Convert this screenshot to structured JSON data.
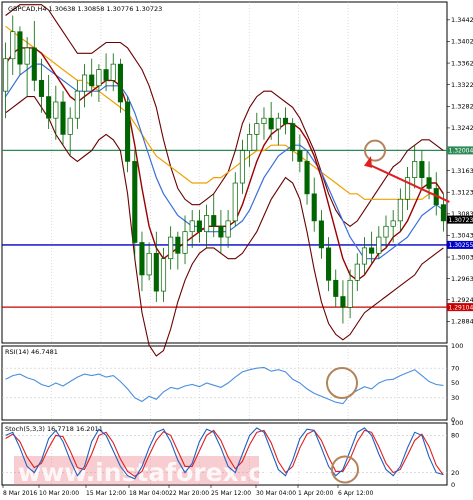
{
  "colors": {
    "background": "#ffffff",
    "frame": "#000000",
    "grid": "#c8c8c8",
    "candle": "#006400",
    "sma_red": "#9b0000",
    "sma_blue": "#3a6fd8",
    "sma_orange": "#f0a000",
    "bollinger": "#6a0000",
    "green_line": "#2e8b57",
    "blue_line": "#0000cc",
    "red_line": "#cc0000",
    "rsi": "#4a8fe0",
    "stoch_main": "#1f5fbf",
    "stoch_signal": "#e02020",
    "annotation": "#b5835a",
    "arrow": "#e02020",
    "watermark": "#e8707a"
  },
  "chart_data": [
    {
      "type": "line",
      "title": "GBPCAD,H4  1.30638 1.30858 1.30776 1.30723",
      "main_price_pane": {
        "symbol": "GBPCAD",
        "timeframe": "H4",
        "ohlc": [
          1.30638,
          1.30858,
          1.30776,
          1.30723
        ],
        "ylim": [
          1.2844,
          1.3475
        ],
        "y_ticks": [
          "1.34420",
          "1.34020",
          "1.33620",
          "1.33220",
          "1.32820",
          "1.32420",
          "1.31630",
          "1.31230",
          "1.30830",
          "1.30430",
          "1.30030",
          "1.29630",
          "1.29240",
          "1.28840"
        ],
        "price_tags": [
          {
            "label": "1.32004",
            "value": 1.32004,
            "line": "green"
          },
          {
            "label": "1.30723",
            "value": 1.30723,
            "line": "current"
          },
          {
            "label": "1.30255",
            "value": 1.30255,
            "line": "blue"
          },
          {
            "label": "1.29104",
            "value": 1.29104,
            "line": "red"
          }
        ],
        "candles": [
          [
            1.331,
            1.34,
            1.326,
            1.337
          ],
          [
            1.337,
            1.345,
            1.334,
            1.342
          ],
          [
            1.342,
            1.343,
            1.334,
            1.336
          ],
          [
            1.336,
            1.341,
            1.33,
            1.339
          ],
          [
            1.339,
            1.344,
            1.331,
            1.333
          ],
          [
            1.333,
            1.337,
            1.327,
            1.33
          ],
          [
            1.33,
            1.334,
            1.324,
            1.326
          ],
          [
            1.326,
            1.332,
            1.322,
            1.329
          ],
          [
            1.329,
            1.331,
            1.321,
            1.323
          ],
          [
            1.323,
            1.328,
            1.319,
            1.326
          ],
          [
            1.326,
            1.333,
            1.324,
            1.331
          ],
          [
            1.331,
            1.336,
            1.328,
            1.334
          ],
          [
            1.334,
            1.337,
            1.33,
            1.332
          ],
          [
            1.332,
            1.336,
            1.329,
            1.335
          ],
          [
            1.335,
            1.338,
            1.331,
            1.333
          ],
          [
            1.333,
            1.338,
            1.331,
            1.336
          ],
          [
            1.336,
            1.337,
            1.327,
            1.329
          ],
          [
            1.329,
            1.33,
            1.316,
            1.318
          ],
          [
            1.318,
            1.32,
            1.3,
            1.303
          ],
          [
            1.303,
            1.305,
            1.294,
            1.297
          ],
          [
            1.297,
            1.303,
            1.296,
            1.301
          ],
          [
            1.301,
            1.305,
            1.292,
            1.294
          ],
          [
            1.294,
            1.302,
            1.292,
            1.3
          ],
          [
            1.3,
            1.306,
            1.298,
            1.304
          ],
          [
            1.304,
            1.305,
            1.298,
            1.301
          ],
          [
            1.301,
            1.308,
            1.299,
            1.305
          ],
          [
            1.305,
            1.309,
            1.302,
            1.307
          ],
          [
            1.307,
            1.309,
            1.303,
            1.305
          ],
          [
            1.305,
            1.31,
            1.302,
            1.308
          ],
          [
            1.308,
            1.312,
            1.304,
            1.306
          ],
          [
            1.306,
            1.309,
            1.301,
            1.304
          ],
          [
            1.304,
            1.309,
            1.302,
            1.307
          ],
          [
            1.307,
            1.316,
            1.306,
            1.314
          ],
          [
            1.314,
            1.322,
            1.312,
            1.32
          ],
          [
            1.32,
            1.325,
            1.317,
            1.323
          ],
          [
            1.323,
            1.327,
            1.32,
            1.325
          ],
          [
            1.325,
            1.328,
            1.322,
            1.326
          ],
          [
            1.326,
            1.329,
            1.322,
            1.324
          ],
          [
            1.324,
            1.327,
            1.321,
            1.326
          ],
          [
            1.326,
            1.328,
            1.323,
            1.325
          ],
          [
            1.325,
            1.326,
            1.318,
            1.32
          ],
          [
            1.32,
            1.323,
            1.316,
            1.318
          ],
          [
            1.318,
            1.32,
            1.31,
            1.312
          ],
          [
            1.312,
            1.315,
            1.305,
            1.307
          ],
          [
            1.307,
            1.309,
            1.3,
            1.302
          ],
          [
            1.302,
            1.304,
            1.294,
            1.296
          ],
          [
            1.296,
            1.298,
            1.291,
            1.293
          ],
          [
            1.293,
            1.296,
            1.288,
            1.291
          ],
          [
            1.291,
            1.298,
            1.289,
            1.296
          ],
          [
            1.296,
            1.301,
            1.294,
            1.299
          ],
          [
            1.299,
            1.304,
            1.297,
            1.302
          ],
          [
            1.302,
            1.305,
            1.299,
            1.301
          ],
          [
            1.301,
            1.306,
            1.3,
            1.304
          ],
          [
            1.304,
            1.308,
            1.302,
            1.306
          ],
          [
            1.306,
            1.309,
            1.303,
            1.307
          ],
          [
            1.307,
            1.313,
            1.305,
            1.311
          ],
          [
            1.311,
            1.317,
            1.309,
            1.315
          ],
          [
            1.315,
            1.321,
            1.313,
            1.318
          ],
          [
            1.318,
            1.32,
            1.313,
            1.315
          ],
          [
            1.315,
            1.318,
            1.311,
            1.313
          ],
          [
            1.313,
            1.316,
            1.308,
            1.31
          ],
          [
            1.31,
            1.312,
            1.305,
            1.307
          ]
        ],
        "sma_red": [
          1.336,
          1.338,
          1.339,
          1.339,
          1.339,
          1.338,
          1.336,
          1.334,
          1.332,
          1.33,
          1.329,
          1.33,
          1.331,
          1.332,
          1.333,
          1.333,
          1.332,
          1.328,
          1.321,
          1.313,
          1.306,
          1.302,
          1.3,
          1.301,
          1.302,
          1.303,
          1.304,
          1.305,
          1.306,
          1.306,
          1.306,
          1.306,
          1.307,
          1.31,
          1.314,
          1.318,
          1.321,
          1.323,
          1.324,
          1.325,
          1.325,
          1.324,
          1.322,
          1.319,
          1.315,
          1.31,
          1.305,
          1.3,
          1.297,
          1.296,
          1.297,
          1.299,
          1.301,
          1.302,
          1.304,
          1.305,
          1.307,
          1.31,
          1.313,
          1.314,
          1.314,
          1.312
        ],
        "sma_blue": [
          1.33,
          1.332,
          1.334,
          1.335,
          1.336,
          1.336,
          1.335,
          1.334,
          1.333,
          1.332,
          1.331,
          1.331,
          1.331,
          1.331,
          1.332,
          1.332,
          1.332,
          1.33,
          1.327,
          1.323,
          1.319,
          1.315,
          1.312,
          1.31,
          1.308,
          1.307,
          1.306,
          1.306,
          1.305,
          1.305,
          1.305,
          1.305,
          1.306,
          1.307,
          1.309,
          1.312,
          1.315,
          1.317,
          1.319,
          1.32,
          1.321,
          1.321,
          1.32,
          1.318,
          1.316,
          1.313,
          1.31,
          1.307,
          1.304,
          1.302,
          1.3,
          1.3,
          1.3,
          1.301,
          1.302,
          1.303,
          1.304,
          1.306,
          1.308,
          1.309,
          1.31,
          1.309
        ],
        "sma_orange": [
          1.343,
          1.342,
          1.341,
          1.34,
          1.339,
          1.338,
          1.337,
          1.336,
          1.335,
          1.334,
          1.333,
          1.333,
          1.332,
          1.331,
          1.33,
          1.329,
          1.328,
          1.327,
          1.325,
          1.323,
          1.321,
          1.319,
          1.318,
          1.317,
          1.316,
          1.315,
          1.314,
          1.314,
          1.314,
          1.315,
          1.315,
          1.316,
          1.317,
          1.318,
          1.319,
          1.32,
          1.32,
          1.321,
          1.321,
          1.321,
          1.32,
          1.319,
          1.318,
          1.317,
          1.316,
          1.315,
          1.314,
          1.313,
          1.312,
          1.312,
          1.311,
          1.311,
          1.311,
          1.311,
          1.311,
          1.311,
          1.311,
          1.311,
          1.311,
          1.312,
          1.312,
          1.311
        ],
        "bollinger_upper": [
          1.345,
          1.346,
          1.347,
          1.347,
          1.347,
          1.347,
          1.346,
          1.344,
          1.342,
          1.34,
          1.338,
          1.338,
          1.338,
          1.339,
          1.34,
          1.34,
          1.34,
          1.339,
          1.337,
          1.335,
          1.332,
          1.328,
          1.322,
          1.317,
          1.313,
          1.311,
          1.31,
          1.31,
          1.311,
          1.312,
          1.314,
          1.316,
          1.32,
          1.325,
          1.328,
          1.33,
          1.331,
          1.331,
          1.33,
          1.329,
          1.328,
          1.326,
          1.323,
          1.32,
          1.316,
          1.312,
          1.309,
          1.307,
          1.306,
          1.307,
          1.309,
          1.311,
          1.313,
          1.315,
          1.317,
          1.318,
          1.32,
          1.321,
          1.322,
          1.322,
          1.321,
          1.32
        ],
        "bollinger_lower": [
          1.327,
          1.328,
          1.329,
          1.33,
          1.33,
          1.328,
          1.326,
          1.323,
          1.321,
          1.319,
          1.318,
          1.319,
          1.32,
          1.322,
          1.323,
          1.322,
          1.32,
          1.312,
          1.3,
          1.29,
          1.284,
          1.282,
          1.283,
          1.287,
          1.292,
          1.296,
          1.299,
          1.301,
          1.302,
          1.302,
          1.301,
          1.3,
          1.3,
          1.301,
          1.303,
          1.305,
          1.308,
          1.311,
          1.313,
          1.315,
          1.314,
          1.311,
          1.305,
          1.298,
          1.292,
          1.288,
          1.286,
          1.285,
          1.286,
          1.288,
          1.29,
          1.291,
          1.292,
          1.293,
          1.294,
          1.295,
          1.296,
          1.297,
          1.299,
          1.3,
          1.301,
          1.302
        ]
      },
      "rsi_pane": {
        "label": "RSI(14) 46.7481",
        "ylim": [
          0,
          100
        ],
        "y_ticks": [
          "100",
          "70",
          "50",
          "30",
          "0"
        ],
        "values": [
          55,
          60,
          62,
          57,
          54,
          48,
          45,
          50,
          46,
          52,
          58,
          62,
          60,
          62,
          58,
          60,
          52,
          42,
          30,
          25,
          32,
          28,
          38,
          44,
          42,
          46,
          48,
          45,
          50,
          47,
          44,
          50,
          58,
          65,
          68,
          70,
          71,
          66,
          68,
          65,
          55,
          50,
          42,
          36,
          32,
          28,
          24,
          22,
          34,
          40,
          45,
          42,
          50,
          54,
          55,
          60,
          64,
          68,
          60,
          52,
          48,
          46.7
        ]
      },
      "stoch_pane": {
        "label": "Stoch(5,3,3) 16.7718 16.2011",
        "ylim": [
          0,
          100
        ],
        "y_ticks": [
          "100",
          "80",
          "20",
          "0"
        ],
        "main": [
          80,
          85,
          60,
          30,
          20,
          40,
          75,
          88,
          70,
          40,
          15,
          30,
          70,
          90,
          80,
          55,
          30,
          15,
          10,
          30,
          60,
          85,
          90,
          70,
          40,
          20,
          35,
          70,
          90,
          85,
          60,
          30,
          20,
          50,
          80,
          92,
          85,
          55,
          25,
          15,
          40,
          75,
          90,
          88,
          60,
          30,
          15,
          25,
          55,
          85,
          92,
          80,
          50,
          25,
          15,
          30,
          60,
          85,
          80,
          45,
          20,
          16.8
        ],
        "signal": [
          75,
          82,
          70,
          45,
          28,
          35,
          60,
          80,
          78,
          55,
          28,
          25,
          50,
          80,
          85,
          68,
          42,
          22,
          14,
          22,
          48,
          72,
          86,
          80,
          55,
          30,
          30,
          55,
          80,
          88,
          72,
          45,
          26,
          38,
          65,
          85,
          88,
          68,
          38,
          20,
          30,
          60,
          82,
          88,
          72,
          45,
          22,
          22,
          42,
          70,
          88,
          85,
          62,
          35,
          20,
          25,
          48,
          72,
          82,
          62,
          32,
          16.2
        ]
      },
      "x_tick_labels": [
        "8 Mar 2016",
        "10 Mar 20:00",
        "15 Mar 12:00",
        "18 Mar 04:00",
        "22 Mar 20:00",
        "25 Mar 12:00",
        "30 Mar 04:00",
        "1 Apr 20:00",
        "6 Apr 12:00"
      ],
      "annotations": [
        {
          "type": "circle",
          "pane": "price",
          "note": "target near 1.32004"
        },
        {
          "type": "arrow",
          "pane": "price",
          "direction": "up"
        },
        {
          "type": "circle",
          "pane": "rsi"
        },
        {
          "type": "circle",
          "pane": "stoch"
        }
      ]
    }
  ],
  "watermark": "www.instaforex.com"
}
